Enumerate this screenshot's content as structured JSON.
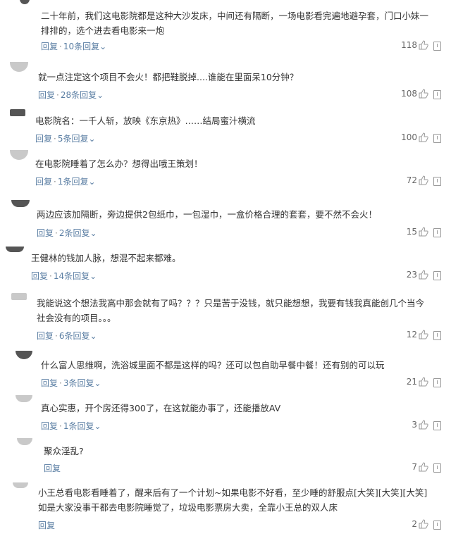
{
  "comments": [
    {
      "text": "二十年前，我们这电影院都是这种大沙发床，中间还有隔断，一场电影看完遍地避孕套，门口小妹一\n排排的，选个进去看电影来一炮",
      "reply": "回复",
      "more": "10条回复",
      "likes": "118"
    },
    {
      "text": "就一点注定这个项目不会火！都把鞋脱掉....谁能在里面呆10分钟？",
      "reply": "回复",
      "more": "28条回复",
      "likes": "108"
    },
    {
      "text": "电影院名：一千人斩，放映《东京热》……结局蜜汁横流",
      "reply": "回复",
      "more": "5条回复",
      "likes": "100"
    },
    {
      "text": "在电影院睡着了怎么办？想得出哦王策划！",
      "reply": "回复",
      "more": "1条回复",
      "likes": "72"
    },
    {
      "text": "两边应该加隔断，旁边提供2包纸巾，一包湿巾，一盒价格合理的套套，要不然不会火！",
      "reply": "回复",
      "more": "2条回复",
      "likes": "15"
    },
    {
      "text": "王健林的钱加人脉，想混不起来都难。",
      "reply": "回复",
      "more": "14条回复",
      "likes": "23"
    },
    {
      "text": "我能说这个想法我高中那会就有了吗？？？只是苦于没钱，就只能想想，我要有钱我真能创几个当今\n社会没有的项目。。。",
      "reply": "回复",
      "more": "6条回复",
      "likes": "12"
    },
    {
      "text": "什么富人思维啊，洗浴城里面不都是这样的吗？还可以包自助早餐中餐！还有别的可以玩",
      "reply": "回复",
      "more": "3条回复",
      "likes": "21"
    },
    {
      "text": "真心实惠，开个房还得300了，在这就能办事了，还能播放AV",
      "reply": "回复",
      "more": "1条回复",
      "likes": "3"
    },
    {
      "text": "聚众淫乱?",
      "reply": "回复",
      "more": "",
      "likes": "7"
    },
    {
      "text": "小王总看电影看睡着了，醒来后有了一个计划~如果电影不好看，至少睡的舒服点[大笑][大笑][大笑]\n如是大家没事干都去电影院睡觉了，垃圾电影票房大卖，全靠小王总的双人床",
      "reply": "回复",
      "more": "",
      "likes": "2"
    }
  ],
  "icons": {
    "like": "thumbs-up-icon",
    "report": "report-icon",
    "expand": "chevron-down-icon"
  }
}
